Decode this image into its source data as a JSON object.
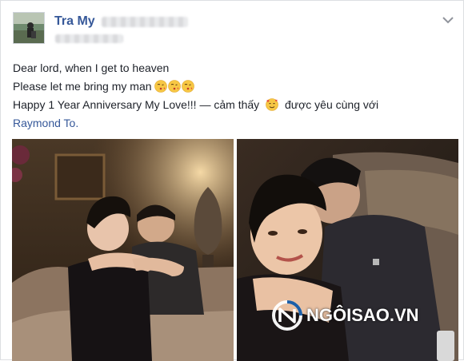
{
  "post": {
    "author": "Tra My",
    "lines": {
      "line1": "Dear lord, when I get to heaven",
      "line2": "Please let me bring my man",
      "line3_text": "Happy 1 Year Anniversary My Love!!! — cảm thấy",
      "line3_after": "được yêu cùng với",
      "tagged_person": "Raymond To."
    },
    "emoji": [
      "kissing-face-icon",
      "kissing-face-icon",
      "kissing-face-icon"
    ],
    "feeling_emoji": "smiling-hearts-face-icon"
  },
  "watermark": {
    "text": "NGÔISAO.VN"
  },
  "colors": {
    "link": "#365899",
    "text": "#1d2129",
    "border": "#dddfe2"
  }
}
